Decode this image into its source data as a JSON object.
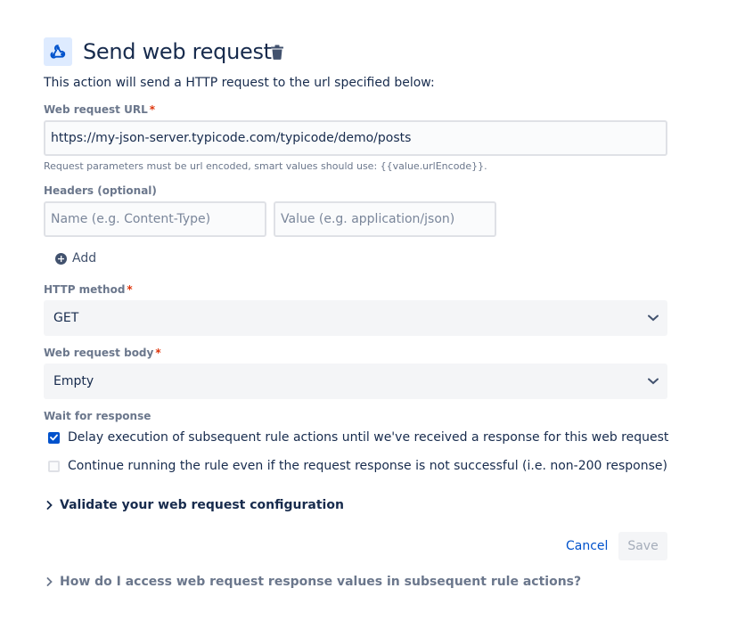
{
  "header": {
    "title": "Send web request",
    "description": "This action will send a HTTP request to the url specified below:"
  },
  "url_field": {
    "label": "Web request URL",
    "required_mark": "*",
    "value": "https://my-json-server.typicode.com/typicode/demo/posts",
    "helper": "Request parameters must be url encoded, smart values should use: {{value.urlEncode}}."
  },
  "headers": {
    "label": "Headers (optional)",
    "name_placeholder": "Name (e.g. Content-Type)",
    "value_placeholder": "Value (e.g. application/json)",
    "add_label": "Add"
  },
  "method": {
    "label": "HTTP method",
    "required_mark": "*",
    "selected": "GET"
  },
  "body": {
    "label": "Web request body",
    "required_mark": "*",
    "selected": "Empty"
  },
  "wait": {
    "label": "Wait for response",
    "options": [
      {
        "label": "Delay execution of subsequent rule actions until we've received a response for this web request",
        "checked": true
      },
      {
        "label": "Continue running the rule even if the request response is not successful (i.e. non-200 response)",
        "checked": false
      }
    ]
  },
  "validate": {
    "label": "Validate your web request configuration"
  },
  "actions": {
    "cancel_label": "Cancel",
    "save_label": "Save"
  },
  "faq": {
    "label": "How do I access web request response values in subsequent rule actions?"
  },
  "colors": {
    "primary": "#0052cc",
    "text": "#172b4d",
    "subtle": "#6b778c",
    "required": "#de350b",
    "icon_bg": "#deebff"
  }
}
